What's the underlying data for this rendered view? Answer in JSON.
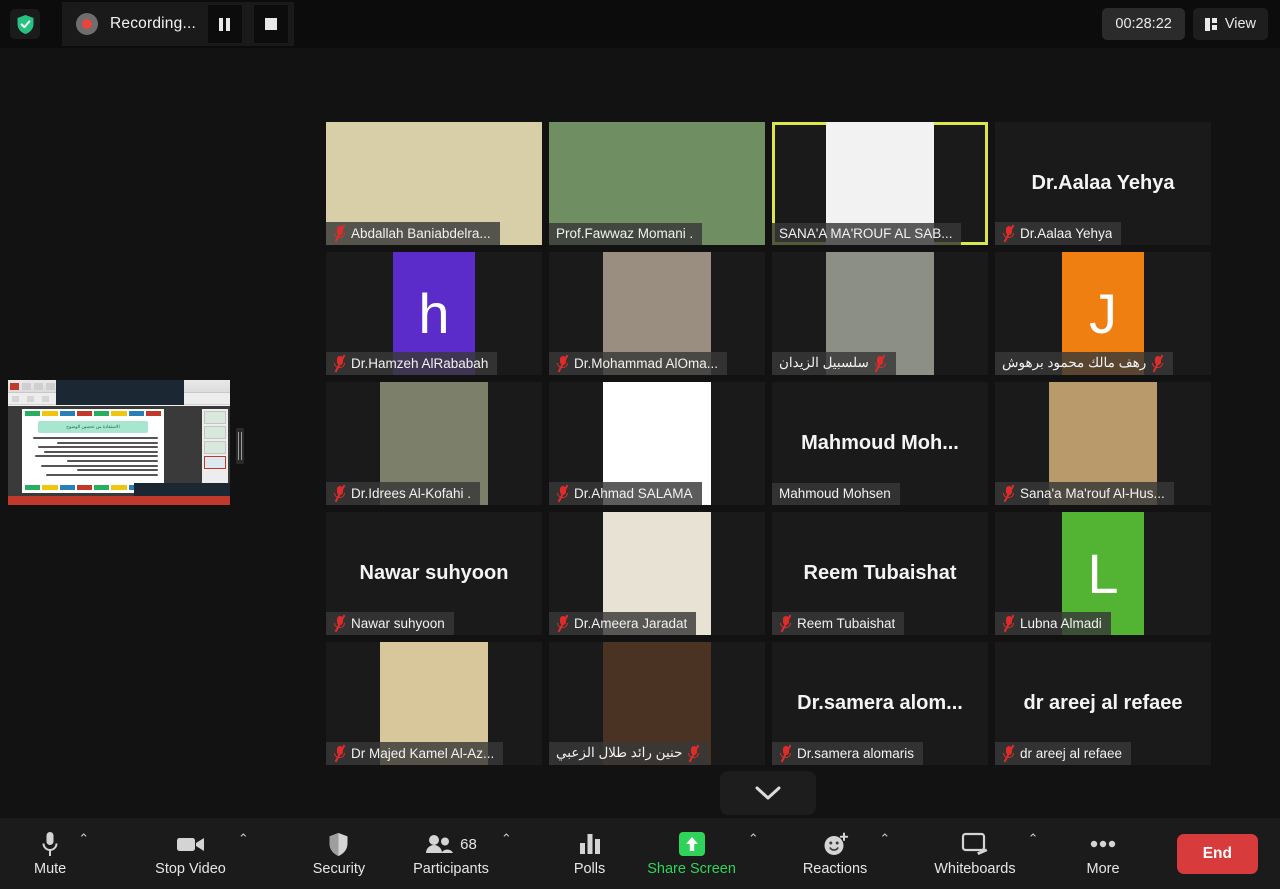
{
  "topbar": {
    "shield_icon": "shield-check-icon",
    "recording": {
      "label": "Recording...",
      "rec_icon": "record-dot-icon",
      "pause_label": "Pause recording",
      "stop_label": "Stop recording"
    },
    "timer": "00:28:22",
    "view_label": "View",
    "view_icon": "grid-layout-icon"
  },
  "share_thumbnail": {
    "name": "shared-screen-thumbnail",
    "handle": "resize-handle",
    "slide_title": "الاستفادة من تحسين الوضوح"
  },
  "scroll_down_icon": "chevron-down-icon",
  "grid": {
    "active_border_color": "#dbe64c",
    "tiles": [
      {
        "name": "Abdallah Baniabdelra...",
        "label": "Abdallah Baniabdelra...",
        "muted": true,
        "kind": "video",
        "active": false,
        "rtl": false,
        "media": {
          "type": "photo-wide",
          "bg": "#d8cfa8"
        }
      },
      {
        "name": "Prof.Fawwaz Momani .",
        "label": "Prof.Fawwaz Momani .",
        "muted": false,
        "kind": "video",
        "active": false,
        "rtl": false,
        "media": {
          "type": "photo-wide",
          "bg": "#6f8f63"
        }
      },
      {
        "name": "SANA'A MA'ROUF AL SAB...",
        "label": "SANA'A MA'ROUF AL SAB...",
        "muted": false,
        "kind": "video",
        "active": true,
        "rtl": false,
        "media": {
          "type": "photo",
          "bg": "#f2f2f2"
        }
      },
      {
        "name": "Dr.Aalaa Yehya",
        "label": "Dr.Aalaa Yehya",
        "muted": true,
        "kind": "name",
        "active": false,
        "rtl": false,
        "media": {
          "type": "name-big"
        }
      },
      {
        "name": "Dr.Hamzeh AlRababah",
        "label": "Dr.Hamzeh AlRababah",
        "muted": true,
        "kind": "letter",
        "active": false,
        "rtl": false,
        "media": {
          "type": "letter",
          "letter": "h",
          "bg": "#5b2cc9"
        }
      },
      {
        "name": "Dr.Mohammad AlOma...",
        "label": "Dr.Mohammad AlOma...",
        "muted": true,
        "kind": "video",
        "active": false,
        "rtl": false,
        "media": {
          "type": "photo",
          "bg": "#9a8e80"
        }
      },
      {
        "name": "سلسبيل الزيدان",
        "label": "سلسبيل  الزيدان",
        "muted": true,
        "kind": "video",
        "active": false,
        "rtl": true,
        "media": {
          "type": "photo",
          "bg": "#8c8f86"
        }
      },
      {
        "name": "رهف مالك محمود برهوش",
        "label": "رهف مالك محمود برهوش",
        "muted": true,
        "kind": "letter",
        "active": false,
        "rtl": true,
        "media": {
          "type": "letter",
          "letter": "J",
          "bg": "#ef7f10"
        }
      },
      {
        "name": "Dr.Idrees Al-Kofahi .",
        "label": "Dr.Idrees Al-Kofahi .",
        "muted": true,
        "kind": "video",
        "active": false,
        "rtl": false,
        "media": {
          "type": "photo",
          "bg": "#7c7f6a"
        }
      },
      {
        "name": "Dr.Ahmad SALAMA",
        "label": "Dr.Ahmad SALAMA",
        "muted": true,
        "kind": "video",
        "active": false,
        "rtl": false,
        "media": {
          "type": "photo",
          "bg": "#ffffff"
        }
      },
      {
        "name": "Mahmoud Mohsen",
        "label": "Mahmoud Mohsen",
        "muted": false,
        "kind": "name",
        "active": false,
        "rtl": false,
        "media": {
          "type": "name-big",
          "display": "Mahmoud  Moh..."
        }
      },
      {
        "name": "Sana'a Ma'rouf Al-Hus...",
        "label": "Sana'a Ma'rouf Al-Hus...",
        "muted": true,
        "kind": "video",
        "active": false,
        "rtl": false,
        "media": {
          "type": "photo",
          "bg": "#b99a6b"
        }
      },
      {
        "name": "Nawar suhyoon",
        "label": "Nawar suhyoon",
        "muted": true,
        "kind": "name",
        "active": false,
        "rtl": false,
        "media": {
          "type": "name-big"
        }
      },
      {
        "name": "Dr.Ameera Jaradat",
        "label": "Dr.Ameera Jaradat",
        "muted": true,
        "kind": "video",
        "active": false,
        "rtl": false,
        "media": {
          "type": "photo",
          "bg": "#e8e2d4"
        }
      },
      {
        "name": "Reem Tubaishat",
        "label": "Reem Tubaishat",
        "muted": true,
        "kind": "name",
        "active": false,
        "rtl": false,
        "media": {
          "type": "name-big"
        }
      },
      {
        "name": "Lubna Almadi",
        "label": "Lubna Almadi",
        "muted": true,
        "kind": "letter",
        "active": false,
        "rtl": false,
        "media": {
          "type": "letter",
          "letter": "L",
          "bg": "#53b333"
        }
      },
      {
        "name": "Dr Majed Kamel Al-Az...",
        "label": "Dr Majed Kamel Al-Az...",
        "muted": true,
        "kind": "video",
        "active": false,
        "rtl": false,
        "media": {
          "type": "photo",
          "bg": "#d7c79a"
        }
      },
      {
        "name": "حنين رائد طلال الزعبي",
        "label": "حنين رائد طلال الزعبي",
        "muted": true,
        "kind": "video",
        "active": false,
        "rtl": true,
        "media": {
          "type": "photo",
          "bg": "#4a3322"
        }
      },
      {
        "name": "Dr.samera alomaris",
        "label": "Dr.samera alomaris",
        "muted": true,
        "kind": "name",
        "active": false,
        "rtl": false,
        "media": {
          "type": "name-big",
          "display": "Dr.samera  alom..."
        }
      },
      {
        "name": "dr areej al refaee",
        "label": "dr areej al refaee",
        "muted": true,
        "kind": "name",
        "active": false,
        "rtl": false,
        "media": {
          "type": "name-big"
        }
      }
    ]
  },
  "toolbar": {
    "items": [
      {
        "label": "Mute",
        "icon": "microphone-icon",
        "caret": true
      },
      {
        "label": "Stop Video",
        "icon": "video-camera-icon",
        "caret": true
      },
      {
        "label": "Security",
        "icon": "shield-icon",
        "caret": false
      },
      {
        "label": "Participants",
        "icon": "people-icon",
        "caret": true,
        "count": "68"
      },
      {
        "label": "Polls",
        "icon": "bar-chart-icon",
        "caret": false
      },
      {
        "label": "Share Screen",
        "icon": "share-screen-arrow-icon",
        "caret": true,
        "green": true
      },
      {
        "label": "Reactions",
        "icon": "smiley-plus-icon",
        "caret": true
      },
      {
        "label": "Whiteboards",
        "icon": "whiteboard-icon",
        "caret": true
      },
      {
        "label": "More",
        "icon": "ellipsis-icon",
        "caret": false
      }
    ],
    "end_label": "End",
    "end_color": "#d83b3b"
  }
}
